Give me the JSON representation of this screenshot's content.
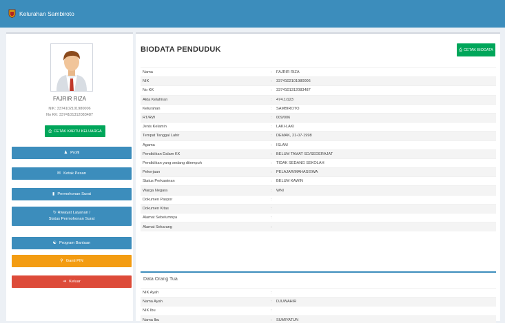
{
  "app": {
    "title": "Kelurahan Sambiroto"
  },
  "profile": {
    "name": "FAJRIR RIZA",
    "nik_line": "NIK: 3374102101980006",
    "kk_line": "No KK: 3374101312083487",
    "print_kk_label": "CETAK KARTU KELUARGA"
  },
  "menu": [
    {
      "label": "Profil",
      "icon": "user-icon"
    },
    {
      "label": "Kotak Pesan",
      "icon": "envelope-icon"
    },
    {
      "label": "Permohonan Surat",
      "icon": "file-icon"
    },
    {
      "label": "Riwayat Layanan / Status Permohonan Surat",
      "line1": "Riwayat Layanan /",
      "line2": "Status Permohonan Surat",
      "icon": "history-icon"
    },
    {
      "label": "Program Bantuan",
      "icon": "handshake-icon"
    },
    {
      "label": "Ganti PIN",
      "icon": "key-icon"
    },
    {
      "label": "Keluar",
      "icon": "sign-out-icon"
    }
  ],
  "main": {
    "title": "BIODATA PENDUDUK",
    "print_label": "CETAK BIODATA"
  },
  "biodata": [
    {
      "label": "Nama",
      "value": "FAJRIR RIZA"
    },
    {
      "label": "NIK",
      "value": "3374102101980006"
    },
    {
      "label": "No KK",
      "value": "3374101312083487"
    },
    {
      "label": "Akta Kelahiran",
      "value": "474.1/123"
    },
    {
      "label": "Kelurahan",
      "value": "SAMBIROTO"
    },
    {
      "label": "RT/RW",
      "value": "009/006"
    },
    {
      "label": "Jenis Kelamin",
      "value": "LAKI-LAKI"
    },
    {
      "label": "Tempat Tanggal Lahir",
      "value": "DEMAK, 21-07-1998"
    },
    {
      "label": "Agama",
      "value": "ISLAM"
    },
    {
      "label": "Pendidikan Dalam KK",
      "value": "BELUM TAMAT SD/SEDERAJAT"
    },
    {
      "label": "Pendidikan yang sedang ditempuh",
      "value": "TIDAK SEDANG SEKOLAH"
    },
    {
      "label": "Pekerjaan",
      "value": "PELAJAR/MAHASISWA"
    },
    {
      "label": "Status Perkawinan",
      "value": "BELUM KAWIN"
    },
    {
      "label": "Warga Negara",
      "value": "WNI"
    },
    {
      "label": "Dokumen Paspor",
      "value": ""
    },
    {
      "label": "Dokumen Kitas",
      "value": ""
    },
    {
      "label": "Alamat Sebelumnya",
      "value": ""
    },
    {
      "label": "Alamat Sekarang",
      "value": ""
    }
  ],
  "orang_tua": {
    "title": "Data Orang Tua",
    "rows": [
      {
        "label": "NIK Ayah",
        "value": ""
      },
      {
        "label": "Nama Ayah",
        "value": "DJUWAHIR"
      },
      {
        "label": "NIK Ibu",
        "value": ""
      },
      {
        "label": "Nama Ibu",
        "value": "SUMIYATUN"
      }
    ]
  },
  "colors": {
    "header": "#3c8dbc",
    "success": "#00a65a",
    "primary": "#3c8dbc",
    "warning": "#f39c12",
    "danger": "#dd4b39"
  }
}
